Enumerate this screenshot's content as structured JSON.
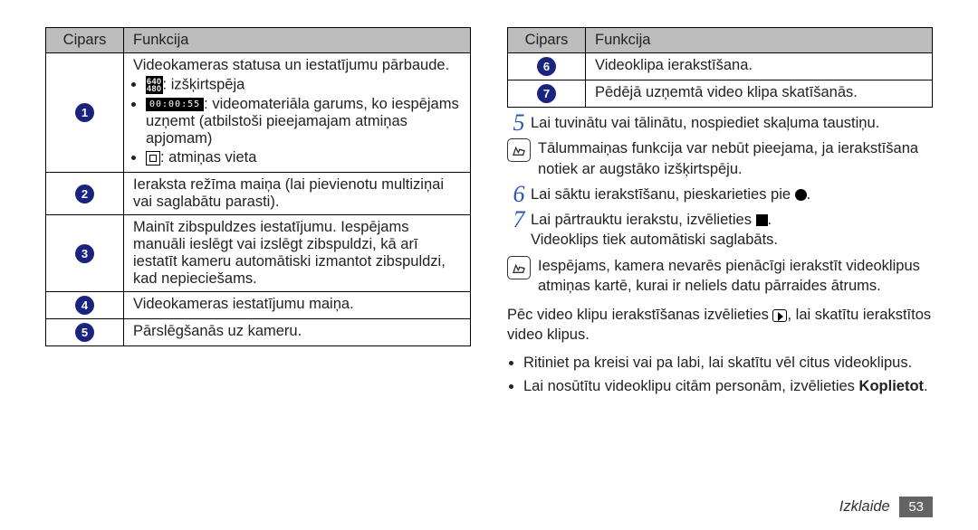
{
  "table_header": {
    "col1": "Cipars",
    "col2": "Funkcija"
  },
  "left_rows": [
    {
      "num": "1",
      "intro": "Videokameras statusa un iestatījumu pārbaude.",
      "bullets": [
        {
          "icon": "res",
          "icon_text": "640\n480",
          "text": ": izšķirtspēja"
        },
        {
          "icon": "time",
          "icon_text": "00:00:55",
          "text": ": videomateriāla garums, ko iespējams uzņemt (atbilstoši pieejamajam atmiņas apjomam)"
        },
        {
          "icon": "mem",
          "text": ": atmiņas vieta"
        }
      ]
    },
    {
      "num": "2",
      "text": "Ieraksta režīma maiņa (lai pievienotu multiziņai vai saglabātu parasti)."
    },
    {
      "num": "3",
      "text": "Mainīt zibspuldzes iestatījumu. Iespējams manuāli ieslēgt vai izslēgt zibspuldzi, kā arī iestatīt kameru automātiski izmantot zibspuldzi, kad nepieciešams."
    },
    {
      "num": "4",
      "text": "Videokameras iestatījumu maiņa."
    },
    {
      "num": "5",
      "text": "Pārslēgšanās uz kameru."
    }
  ],
  "right_rows": [
    {
      "num": "6",
      "text": "Videoklipa ierakstīšana."
    },
    {
      "num": "7",
      "text": "Pēdējā uzņemtā video klipa skatīšanās."
    }
  ],
  "steps": {
    "s5": "Lai tuvinātu vai tālinātu, nospiediet skaļuma taustiņu.",
    "note1": "Tālummaiņas funkcija var nebūt pieejama, ja ierakstīšana notiek ar augstāko izšķirtspēju.",
    "s6a": "Lai sāktu ierakstīšanu, pieskarieties pie ",
    "s6b": ".",
    "s7a": "Lai pārtrauktu ierakstu, izvēlieties ",
    "s7b": ".",
    "s7_after": "Videoklips tiek automātiski saglabāts.",
    "note2": "Iespējams, kamera nevarēs pienācīgi ierakstīt videoklipus atmiņas kartē, kurai ir neliels datu pārraides ātrums."
  },
  "after_para_a": "Pēc video klipu ierakstīšanas izvēlieties ",
  "after_para_b": ", lai skatītu ierakstītos video klipus.",
  "bullets_after": [
    "Ritiniet pa kreisi vai pa labi, lai skatītu vēl citus videoklipus.",
    "Lai nosūtītu videoklipu citām personām, izvēlieties "
  ],
  "koplietot": "Koplietot",
  "footer": {
    "section": "Izklaide",
    "page": "53"
  }
}
